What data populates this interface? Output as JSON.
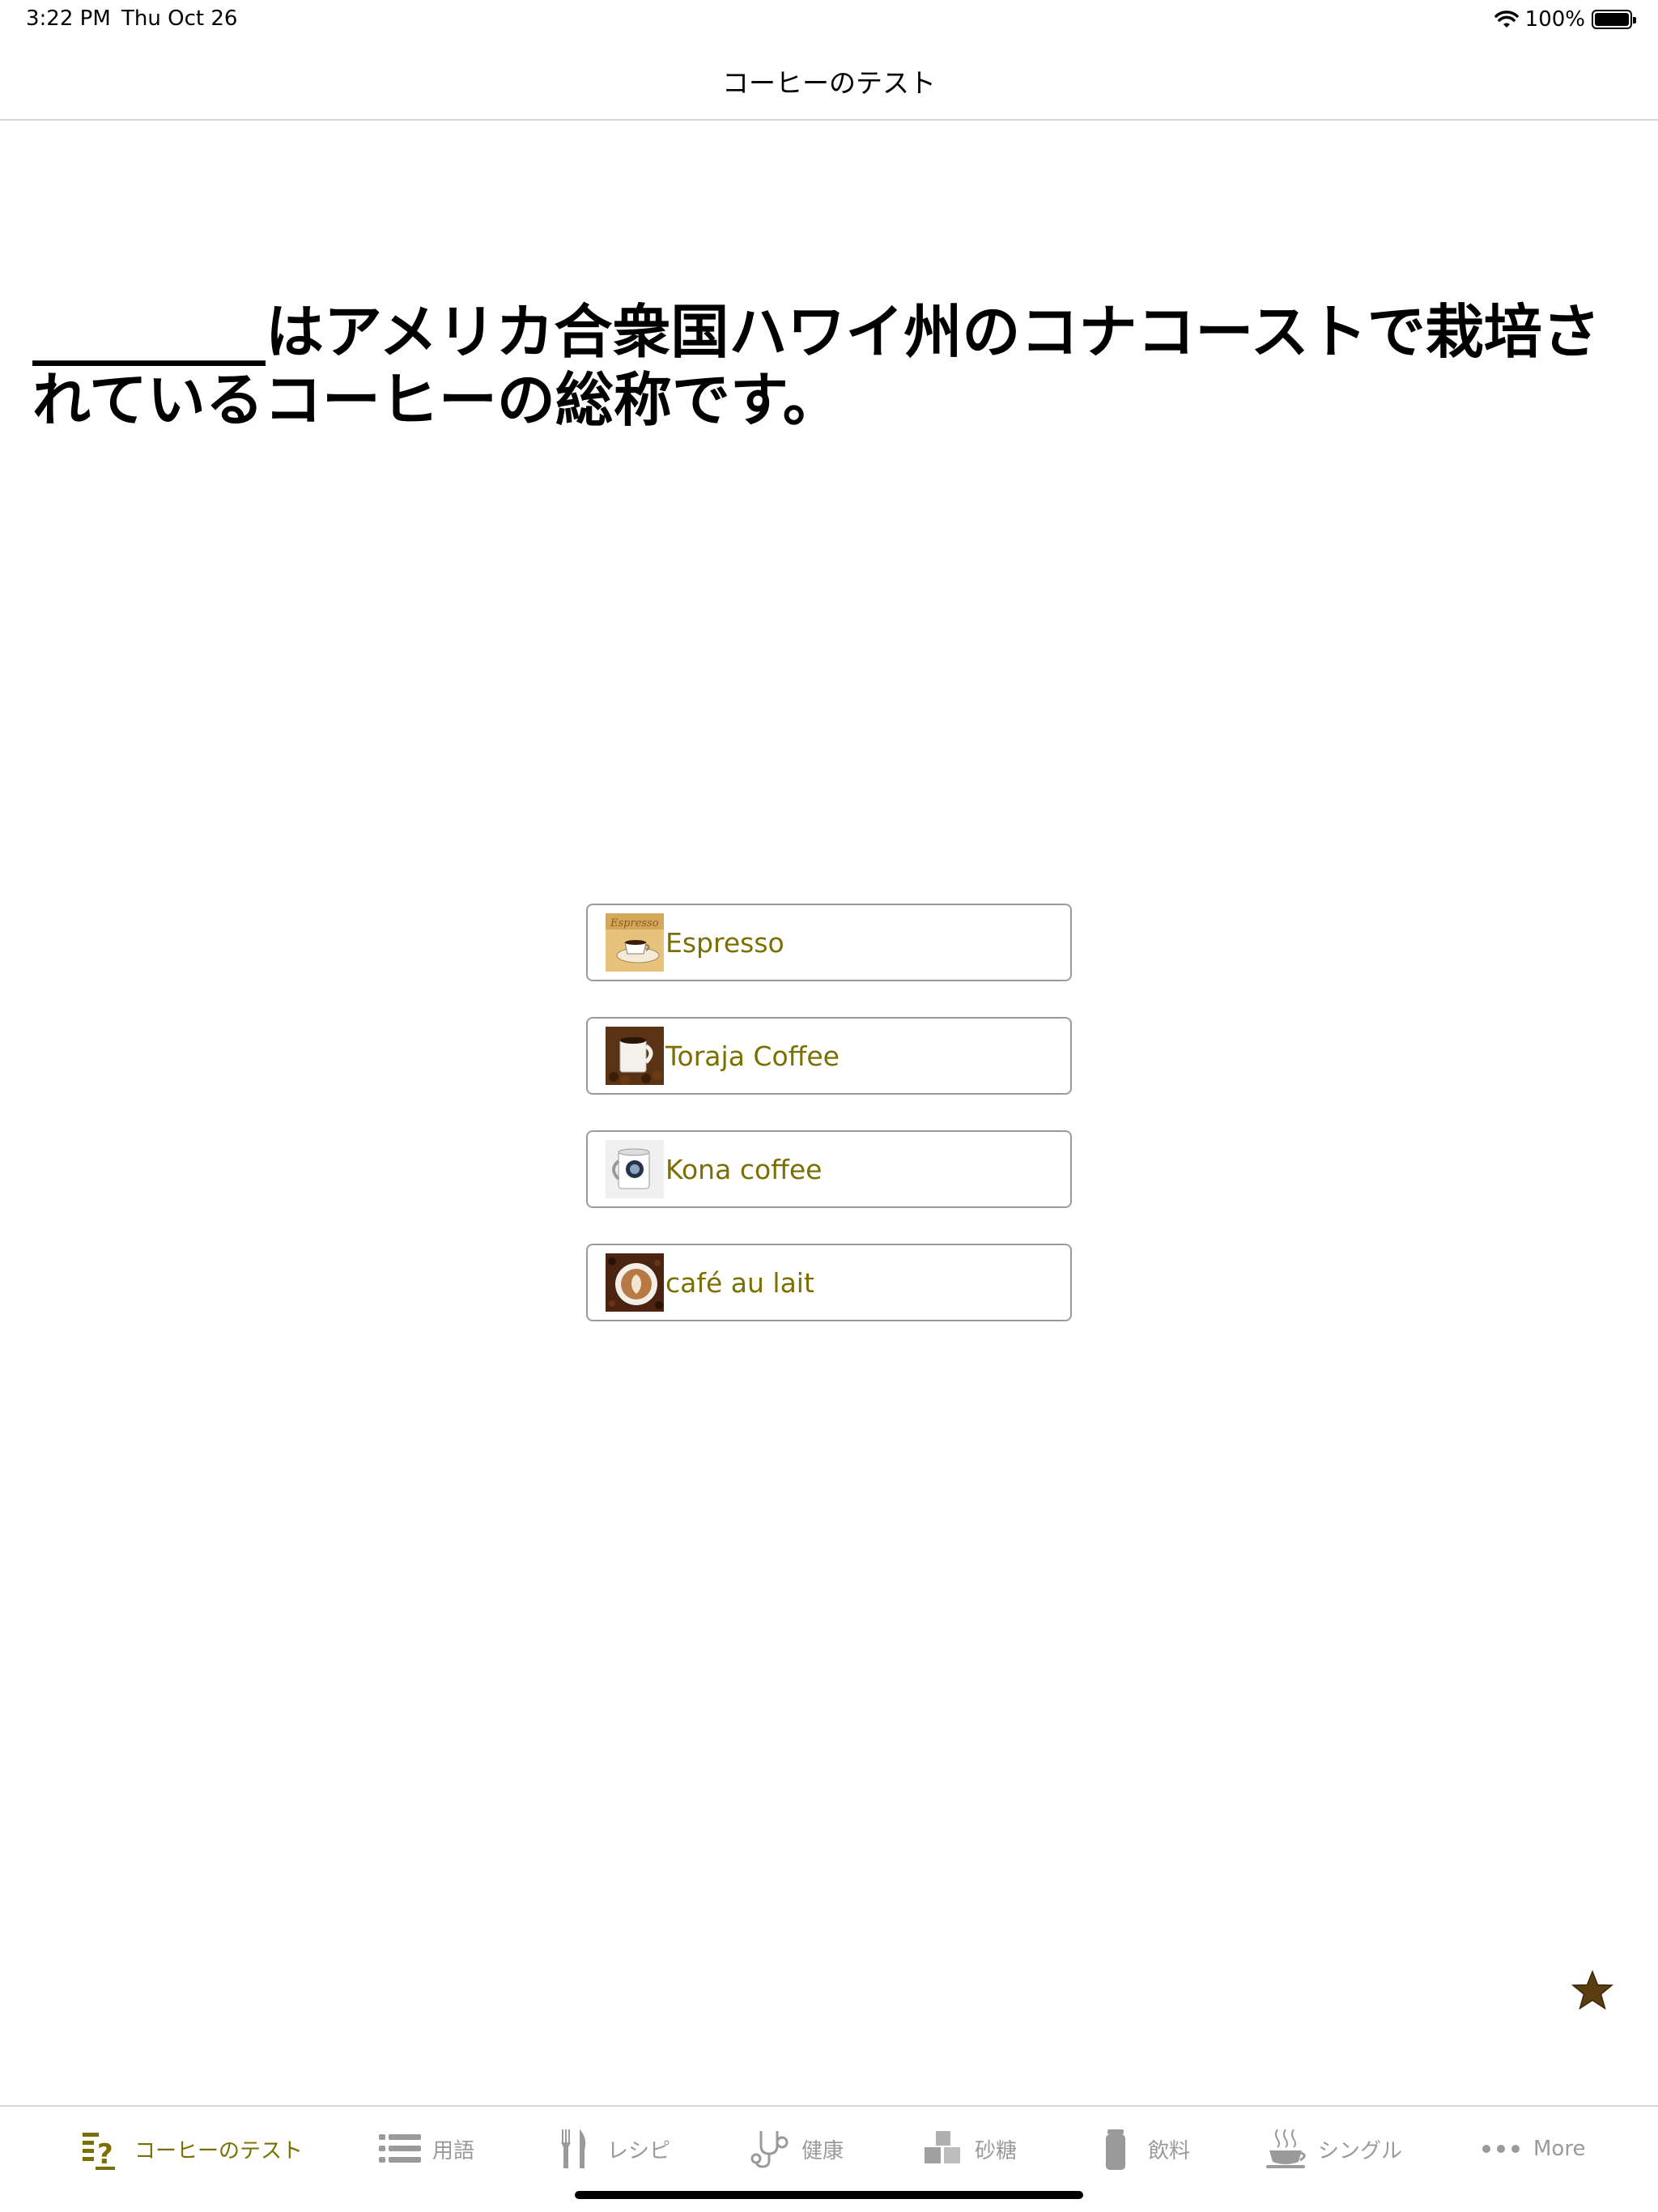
{
  "status_bar": {
    "time": "3:22 PM",
    "date": "Thu Oct 26",
    "battery_percent_text": "100%",
    "battery_level": 1.0
  },
  "nav": {
    "title": "コーヒーのテスト"
  },
  "question": {
    "text": "________はアメリカ合衆国ハワイ州のコナコーストで栽培されているコーヒーの総称です。"
  },
  "answers": [
    {
      "label": "Espresso",
      "thumb_icon": "espresso-cup-icon"
    },
    {
      "label": "Toraja Coffee",
      "thumb_icon": "mug-on-beans-icon"
    },
    {
      "label": "Kona coffee",
      "thumb_icon": "kona-mug-icon"
    },
    {
      "label": "café au lait",
      "thumb_icon": "latte-art-icon"
    }
  ],
  "favorite": {
    "icon": "star-icon",
    "color": "#5a3d10"
  },
  "tabs": [
    {
      "label": "コーヒーのテスト",
      "icon": "quiz-list-icon",
      "active": true
    },
    {
      "label": "用語",
      "icon": "list-icon",
      "active": false
    },
    {
      "label": "レシピ",
      "icon": "fork-knife-icon",
      "active": false
    },
    {
      "label": "健康",
      "icon": "stethoscope-icon",
      "active": false
    },
    {
      "label": "砂糖",
      "icon": "sugar-cubes-icon",
      "active": false
    },
    {
      "label": "飲料",
      "icon": "bottle-icon",
      "active": false
    },
    {
      "label": "シングル",
      "icon": "steaming-cup-icon",
      "active": false
    },
    {
      "label": "More",
      "icon": "more-dots-icon",
      "active": false
    }
  ],
  "colors": {
    "accent": "#7a6f00",
    "inactive": "#9a9a9a",
    "border": "#9a9a9a"
  }
}
